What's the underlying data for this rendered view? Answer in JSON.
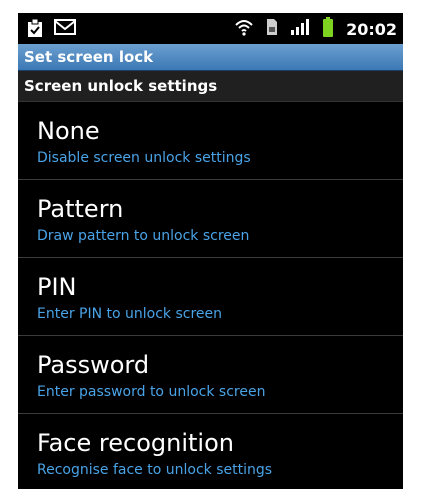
{
  "status_bar": {
    "time": "20:02",
    "icons": [
      "clipboard-check-icon",
      "mail-icon",
      "wifi-icon",
      "sim-icon",
      "signal-icon",
      "battery-icon"
    ]
  },
  "title_bar": {
    "title": "Set screen lock"
  },
  "section": {
    "header": "Screen unlock settings"
  },
  "options": [
    {
      "title": "None",
      "subtitle": "Disable screen unlock settings"
    },
    {
      "title": "Pattern",
      "subtitle": "Draw pattern to unlock screen"
    },
    {
      "title": "PIN",
      "subtitle": "Enter PIN to unlock screen"
    },
    {
      "title": "Password",
      "subtitle": "Enter password to unlock screen"
    },
    {
      "title": "Face recognition",
      "subtitle": "Recognise face to unlock settings"
    }
  ],
  "colors": {
    "title_bar": "#4a86c0",
    "subtitle_text": "#4aa3e6",
    "battery": "#7ed321"
  }
}
